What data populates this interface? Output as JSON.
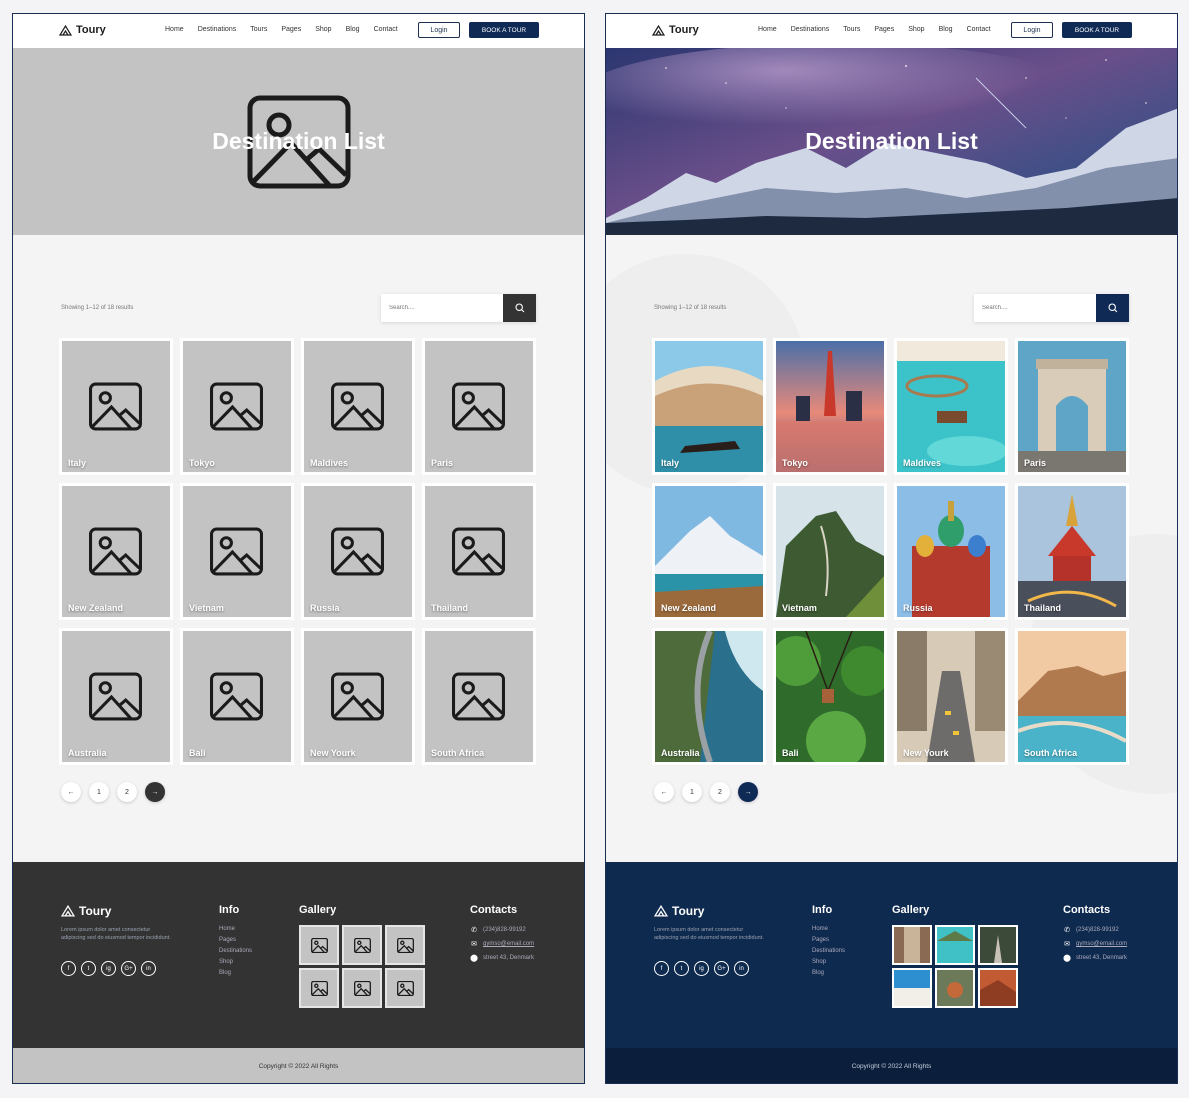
{
  "brand": {
    "name": "Toury"
  },
  "nav": {
    "items": [
      "Home",
      "Destinations",
      "Tours",
      "Pages",
      "Shop",
      "Blog",
      "Contact"
    ],
    "login_label": "Login",
    "book_label": "BOOK A TOUR"
  },
  "hero": {
    "title": "Destination List"
  },
  "listing": {
    "results_text": "Showing 1–12 of 18 results",
    "search_placeholder": "Search....",
    "destinations": [
      "Italy",
      "Tokyo",
      "Maldives",
      "Paris",
      "New Zealand",
      "Vietnam",
      "Russia",
      "Thailand",
      "Australia",
      "Bali",
      "New Yourk",
      "South Africa"
    ]
  },
  "pagination": {
    "prev": "←",
    "pages": [
      "1",
      "2"
    ],
    "next": "→"
  },
  "footer": {
    "description": "Lorem ipsum dolor amet consectetur adipiscing sed do eiusmod tempor incididunt.",
    "social": [
      "f",
      "t",
      "ig",
      "G+",
      "in"
    ],
    "info_heading": "Info",
    "info_links": [
      "Home",
      "Pages",
      "Destinations",
      "Shop",
      "Blog"
    ],
    "gallery_heading": "Gallery",
    "contacts_heading": "Contacts",
    "phone": "(234)828-99192",
    "email": "gymso@email.com",
    "address": "street 43, Denmark",
    "copyright": "Copyright © 2022 All Rights"
  },
  "colors": {
    "navy": "#0f2a55",
    "wire_gray": "#c3c3c3",
    "wire_dark": "#333333"
  },
  "icons": {
    "search": "search-icon",
    "placeholder": "image-placeholder-icon",
    "phone": "phone-icon",
    "mail": "mail-icon",
    "location": "location-pin-icon"
  }
}
